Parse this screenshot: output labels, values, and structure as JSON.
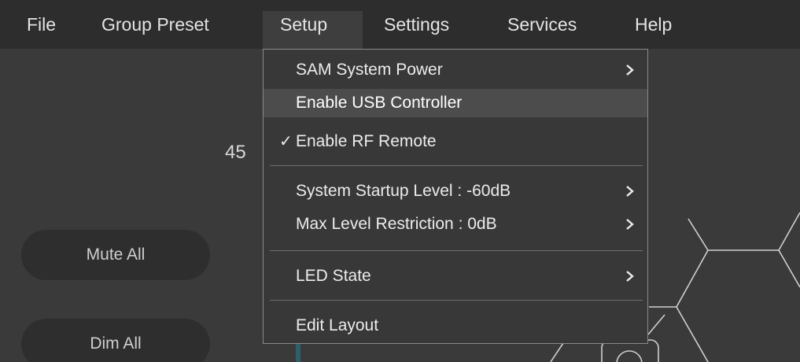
{
  "menubar": {
    "file": "File",
    "group_preset": "Group Preset",
    "setup": "Setup",
    "settings": "Settings",
    "services": "Services",
    "help": "Help"
  },
  "setup_menu": {
    "items": [
      {
        "label": "SAM System Power",
        "has_submenu": true,
        "checked": false
      },
      {
        "label": "Enable USB Controller",
        "has_submenu": false,
        "checked": false,
        "highlighted": true
      },
      {
        "label": "Enable RF Remote",
        "has_submenu": false,
        "checked": true
      },
      {
        "label": "System Startup Level : -60dB",
        "has_submenu": true,
        "checked": false
      },
      {
        "label": "Max Level Restriction : 0dB",
        "has_submenu": true,
        "checked": false
      },
      {
        "label": "LED State",
        "has_submenu": true,
        "checked": false
      },
      {
        "label": "Edit Layout",
        "has_submenu": false,
        "checked": false
      }
    ],
    "check_glyph": "✓"
  },
  "main": {
    "level_readout": "45",
    "mute_all": "Mute All",
    "dim_all": "Dim All"
  },
  "colors": {
    "menubar_bg": "#2d2d2d",
    "app_bg": "#3a3a3a",
    "menu_bg": "#383838",
    "highlight_bg": "#4c4c4c"
  }
}
